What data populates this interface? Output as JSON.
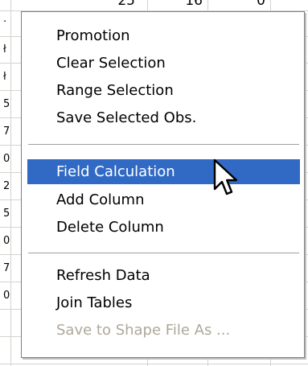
{
  "background_grid": {
    "top_row_values": [
      "25",
      "16",
      "0"
    ],
    "left_column_glyphs": [
      "·",
      "ł",
      "ł",
      "5",
      "7",
      "0",
      "2",
      "5",
      "0",
      "7",
      "0"
    ]
  },
  "context_menu": {
    "groups": [
      {
        "items": [
          {
            "label": "Promotion",
            "state": "normal"
          },
          {
            "label": "Clear Selection",
            "state": "normal"
          },
          {
            "label": "Range Selection",
            "state": "normal"
          },
          {
            "label": "Save Selected Obs.",
            "state": "normal"
          }
        ]
      },
      {
        "items": [
          {
            "label": "Field Calculation",
            "state": "highlighted"
          },
          {
            "label": "Add Column",
            "state": "normal"
          },
          {
            "label": "Delete Column",
            "state": "normal"
          }
        ]
      },
      {
        "items": [
          {
            "label": "Refresh Data",
            "state": "normal"
          },
          {
            "label": "Join Tables",
            "state": "normal"
          },
          {
            "label": "Save to Shape File As ...",
            "state": "disabled"
          }
        ]
      }
    ]
  },
  "colors": {
    "highlight_background": "#316ac5",
    "highlight_text": "#ffffff",
    "disabled_text": "#aca899",
    "grid_lines": "#d6d3ce"
  },
  "cursor": {
    "icon": "arrow-pointer-icon"
  }
}
